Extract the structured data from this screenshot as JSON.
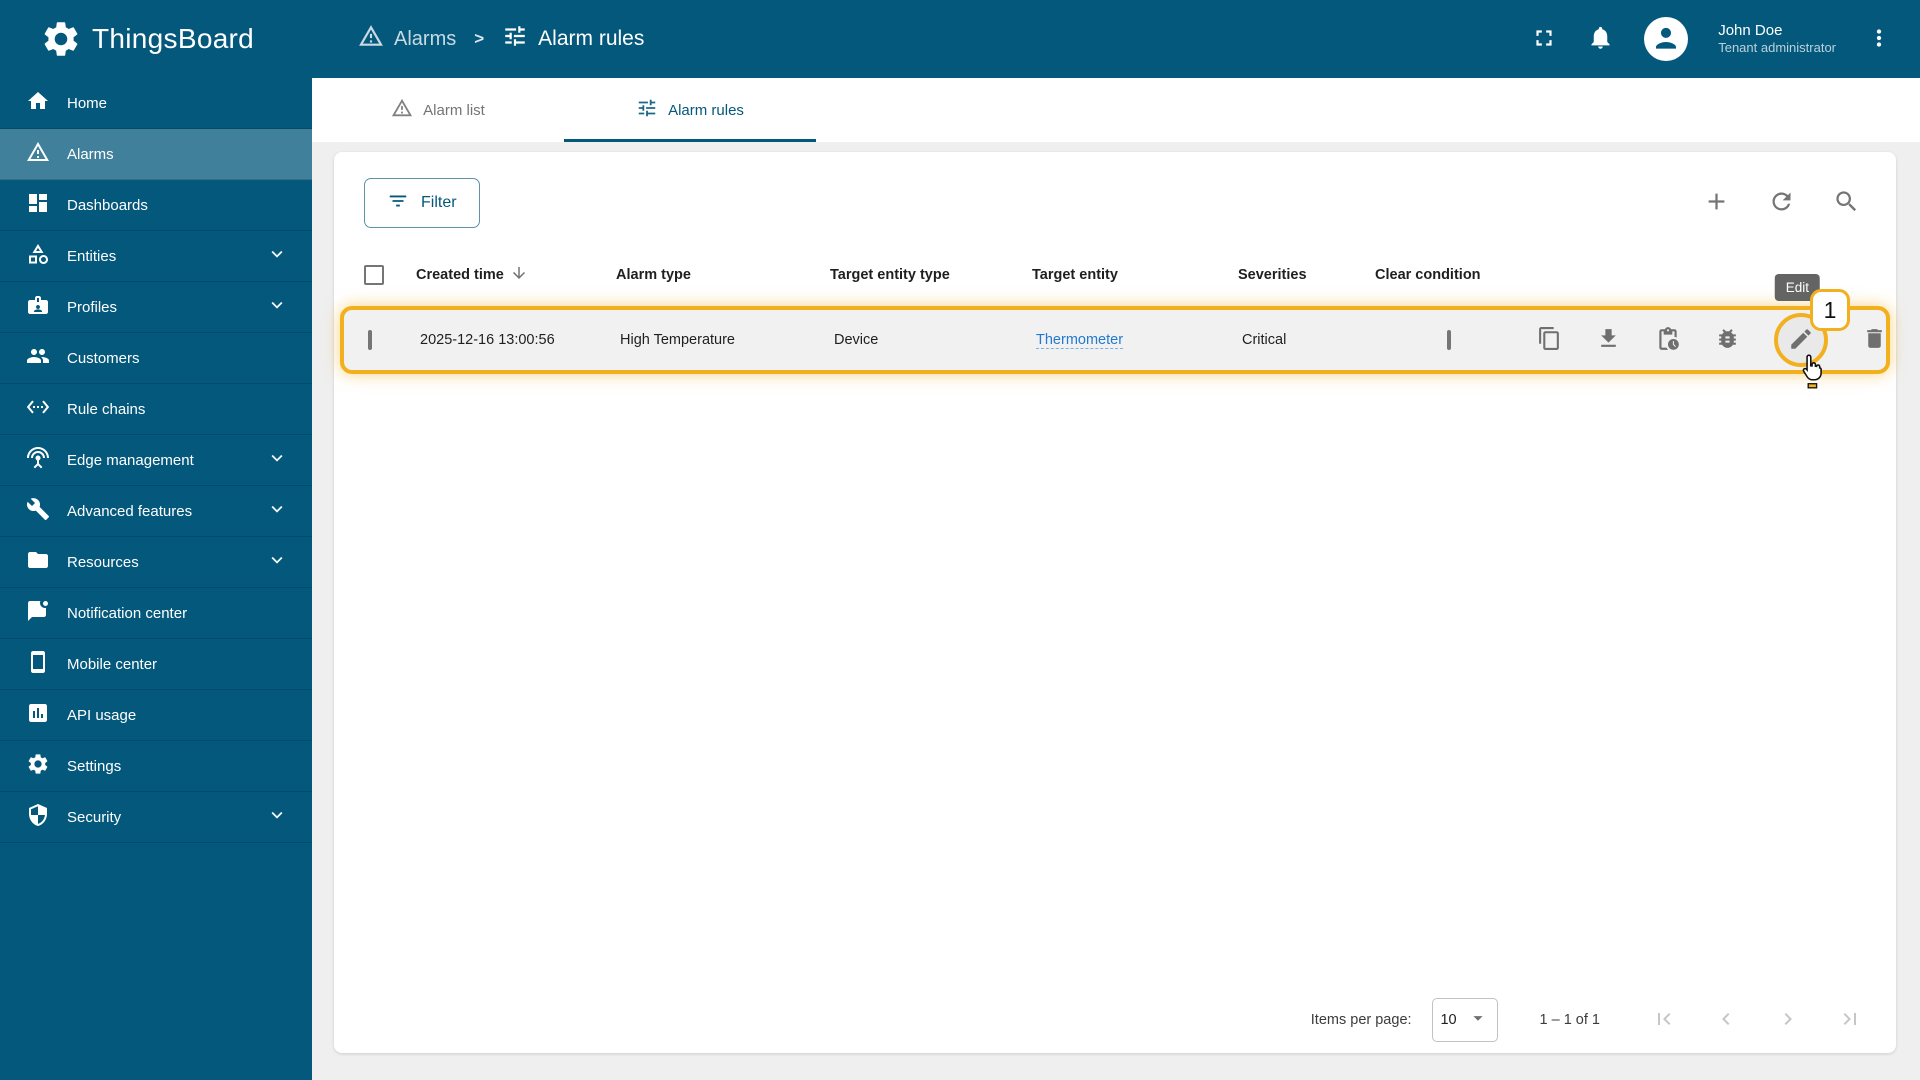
{
  "header": {
    "app_title": "ThingsBoard",
    "breadcrumb": {
      "parent": "Alarms",
      "separator": ">",
      "current": "Alarm rules"
    },
    "user": {
      "name": "John Doe",
      "role": "Tenant administrator"
    }
  },
  "sidebar": {
    "items": [
      {
        "label": "Home"
      },
      {
        "label": "Alarms"
      },
      {
        "label": "Dashboards"
      },
      {
        "label": "Entities"
      },
      {
        "label": "Profiles"
      },
      {
        "label": "Customers"
      },
      {
        "label": "Rule chains"
      },
      {
        "label": "Edge management"
      },
      {
        "label": "Advanced features"
      },
      {
        "label": "Resources"
      },
      {
        "label": "Notification center"
      },
      {
        "label": "Mobile center"
      },
      {
        "label": "API usage"
      },
      {
        "label": "Settings"
      },
      {
        "label": "Security"
      }
    ]
  },
  "tabs": [
    {
      "label": "Alarm list"
    },
    {
      "label": "Alarm rules"
    }
  ],
  "toolbar": {
    "filter_label": "Filter"
  },
  "table": {
    "headers": {
      "created_time": "Created time",
      "alarm_type": "Alarm type",
      "target_entity_type": "Target entity type",
      "target_entity": "Target entity",
      "severities": "Severities",
      "clear_condition": "Clear condition"
    },
    "rows": [
      {
        "created_time": "2025-12-16 13:00:56",
        "alarm_type": "High Temperature",
        "target_entity_type": "Device",
        "target_entity": "Thermometer",
        "severities": "Critical"
      }
    ]
  },
  "highlight": {
    "tooltip": "Edit",
    "step_badge": "1"
  },
  "pagination": {
    "items_per_page_label": "Items per page:",
    "page_size": "10",
    "range_label": "1 – 1 of 1"
  },
  "colors": {
    "primary": "#04587c",
    "sidebar_active": "rgba(255,255,255,0.24)",
    "highlight_amber": "#f2b01e",
    "link_blue": "#1f7ad0",
    "tooltip_bg": "#646464",
    "page_bg": "#efefef"
  }
}
